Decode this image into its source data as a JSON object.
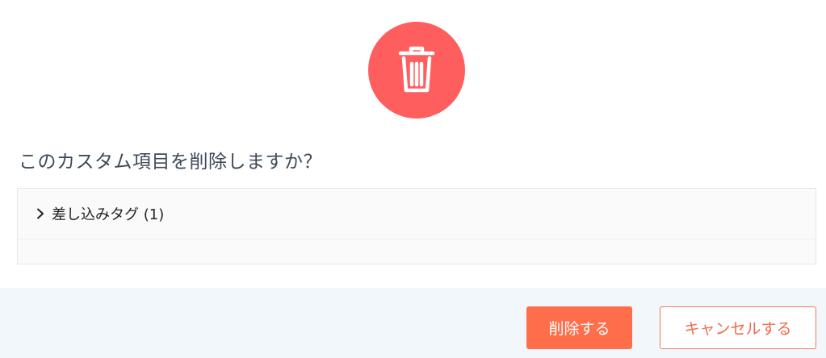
{
  "dialog": {
    "icon": "trash-icon",
    "question": "このカスタム項目を削除しますか？",
    "panel": {
      "items": [
        {
          "label": "差し込みタグ (1)",
          "icon": "chevron-right-icon"
        }
      ]
    },
    "buttons": {
      "delete_label": "削除する",
      "cancel_label": "キャンセルする"
    }
  },
  "colors": {
    "danger": "#ff5e5e",
    "accent": "#ff6e4a",
    "footer_bg": "#f1f7fb"
  }
}
